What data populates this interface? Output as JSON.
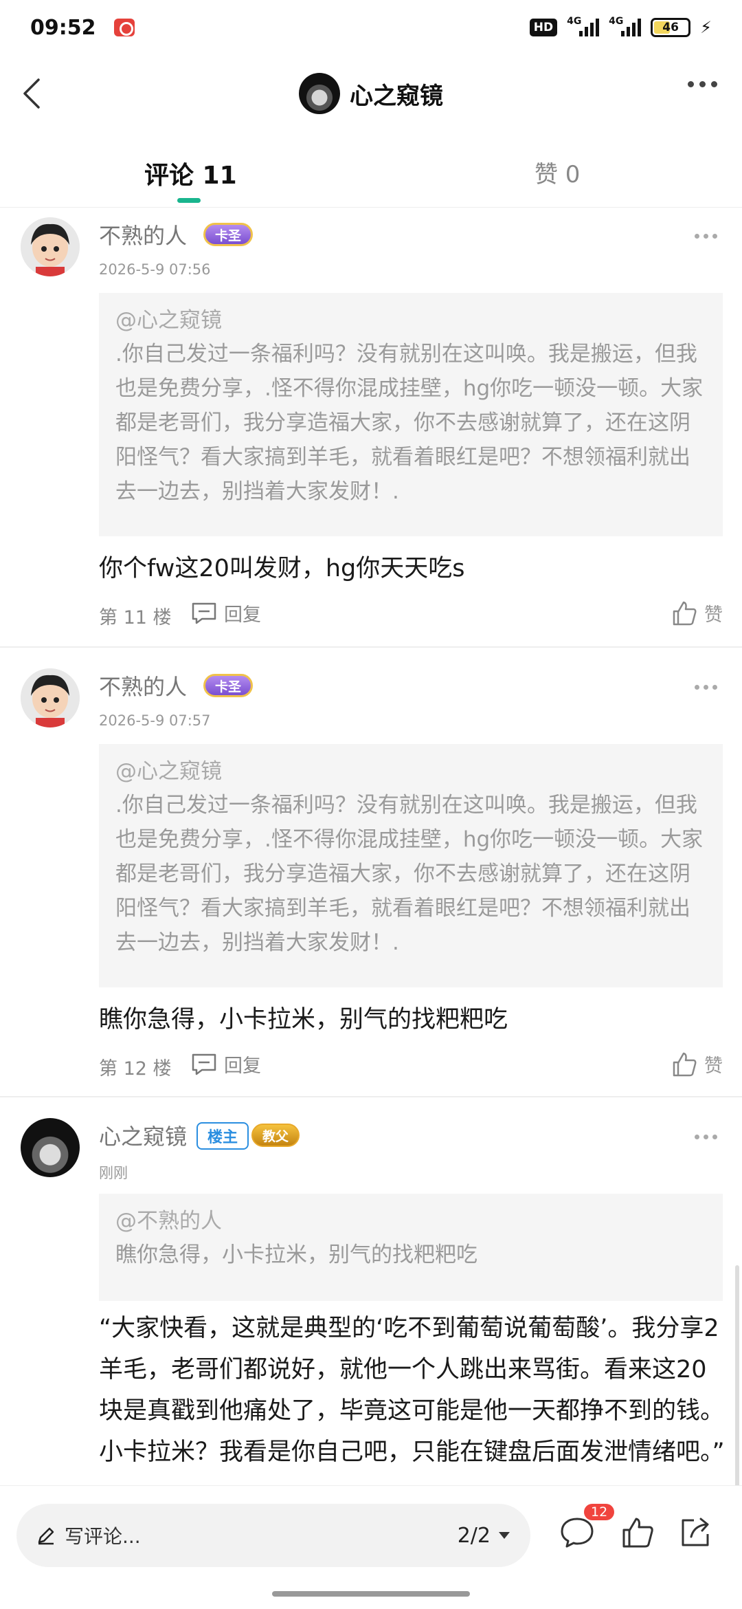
{
  "status_bar": {
    "time": "09:52",
    "hd": "HD",
    "network1": "4G",
    "network2": "4G",
    "battery": "46"
  },
  "header": {
    "title": "心之窥镜"
  },
  "tabs": [
    {
      "label": "评论 11",
      "active": true
    },
    {
      "label": "赞 0",
      "active": false
    }
  ],
  "comments": [
    {
      "author": "不熟的人",
      "badge": "卡圣",
      "time": "2026-5-9 07:56",
      "quote_author": "@心之窥镜",
      "quote_text": ".你自己发过一条福利吗？没有就别在这叫唤。我是搬运，但我也是免费分享，.怪不得你混成挂壁，hg你吃一顿没一顿。大家都是老哥们，我分享造福大家，你不去感谢就算了，还在这阴阳怪气？看大家搞到羊毛，就看着眼红是吧？不想领福利就出去一边去，别挡着大家发财！.",
      "body": "你个fw这20叫发财，hg你天天吃s",
      "floor": "第 11 楼",
      "reply": "回复",
      "like": "赞"
    },
    {
      "author": "不熟的人",
      "badge": "卡圣",
      "time": "2026-5-9 07:57",
      "quote_author": "@心之窥镜",
      "quote_text": ".你自己发过一条福利吗？没有就别在这叫唤。我是搬运，但我也是免费分享，.怪不得你混成挂壁，hg你吃一顿没一顿。大家都是老哥们，我分享造福大家，你不去感谢就算了，还在这阴阳怪气？看大家搞到羊毛，就看着眼红是吧？不想领福利就出去一边去，别挡着大家发财！.",
      "body": "瞧你急得，小卡拉米，别气的找粑粑吃",
      "floor": "第 12 楼",
      "reply": "回复",
      "like": "赞"
    },
    {
      "author": "心之窥镜",
      "owner_badge": "楼主",
      "badge": "教父",
      "time": "刚刚",
      "quote_author": "@不熟的人",
      "quote_text": "瞧你急得，小卡拉米，别气的找粑粑吃",
      "body": "“大家快看，这就是典型的‘吃不到葡萄说葡萄酸’。我分享2羊毛，老哥们都说好，就他一个人跳出来骂街。看来这20块是真戳到他痛处了，毕竟这可能是他一天都挣不到的钱。小卡拉米？我看是你自己吧，只能在键盘后面发泄情绪吧。”"
    }
  ],
  "bottom_bar": {
    "compose_placeholder": "写评论...",
    "page": "2/2",
    "comment_count": "12"
  },
  "colors": {
    "accent": "#19b58e",
    "badge_red": "#f0443e",
    "owner_blue": "#2a8ee0"
  }
}
